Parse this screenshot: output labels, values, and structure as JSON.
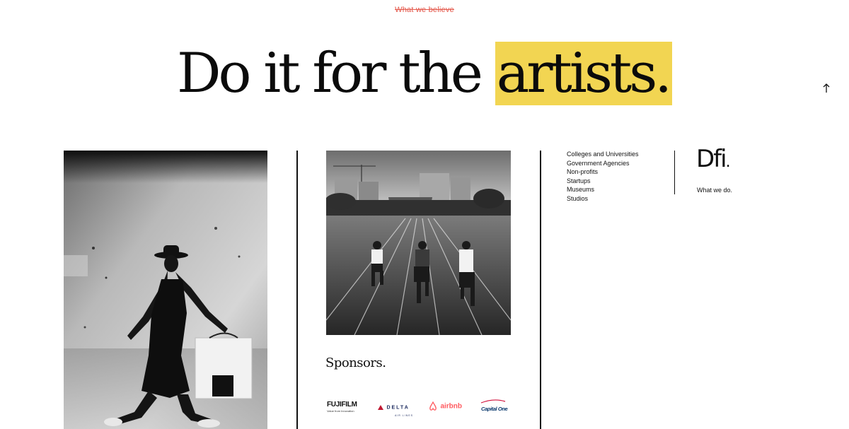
{
  "eyebrow": "What we believe",
  "headline": {
    "lead": "Do it for the ",
    "highlight": "artists."
  },
  "colors": {
    "accent": "#e4574a",
    "highlight": "#f2d552",
    "ink": "#111111"
  },
  "scroll_top_icon": "arrow-up-icon",
  "sponsors": {
    "title": "Sponsors.",
    "logos": [
      {
        "name": "FUJIFILM",
        "tagline": "Value from Innovation"
      },
      {
        "name": "DELTA",
        "tagline": "AIR LINES"
      },
      {
        "name": "airbnb"
      },
      {
        "name": "Capital One"
      }
    ]
  },
  "menu": {
    "items": [
      "Colleges and Universities",
      "Government Agencies",
      "Non-profits",
      "Startups",
      "Museums",
      "Studios"
    ]
  },
  "brand": {
    "logo": "Dfi",
    "dot": ".",
    "subtitle": "What we do."
  }
}
